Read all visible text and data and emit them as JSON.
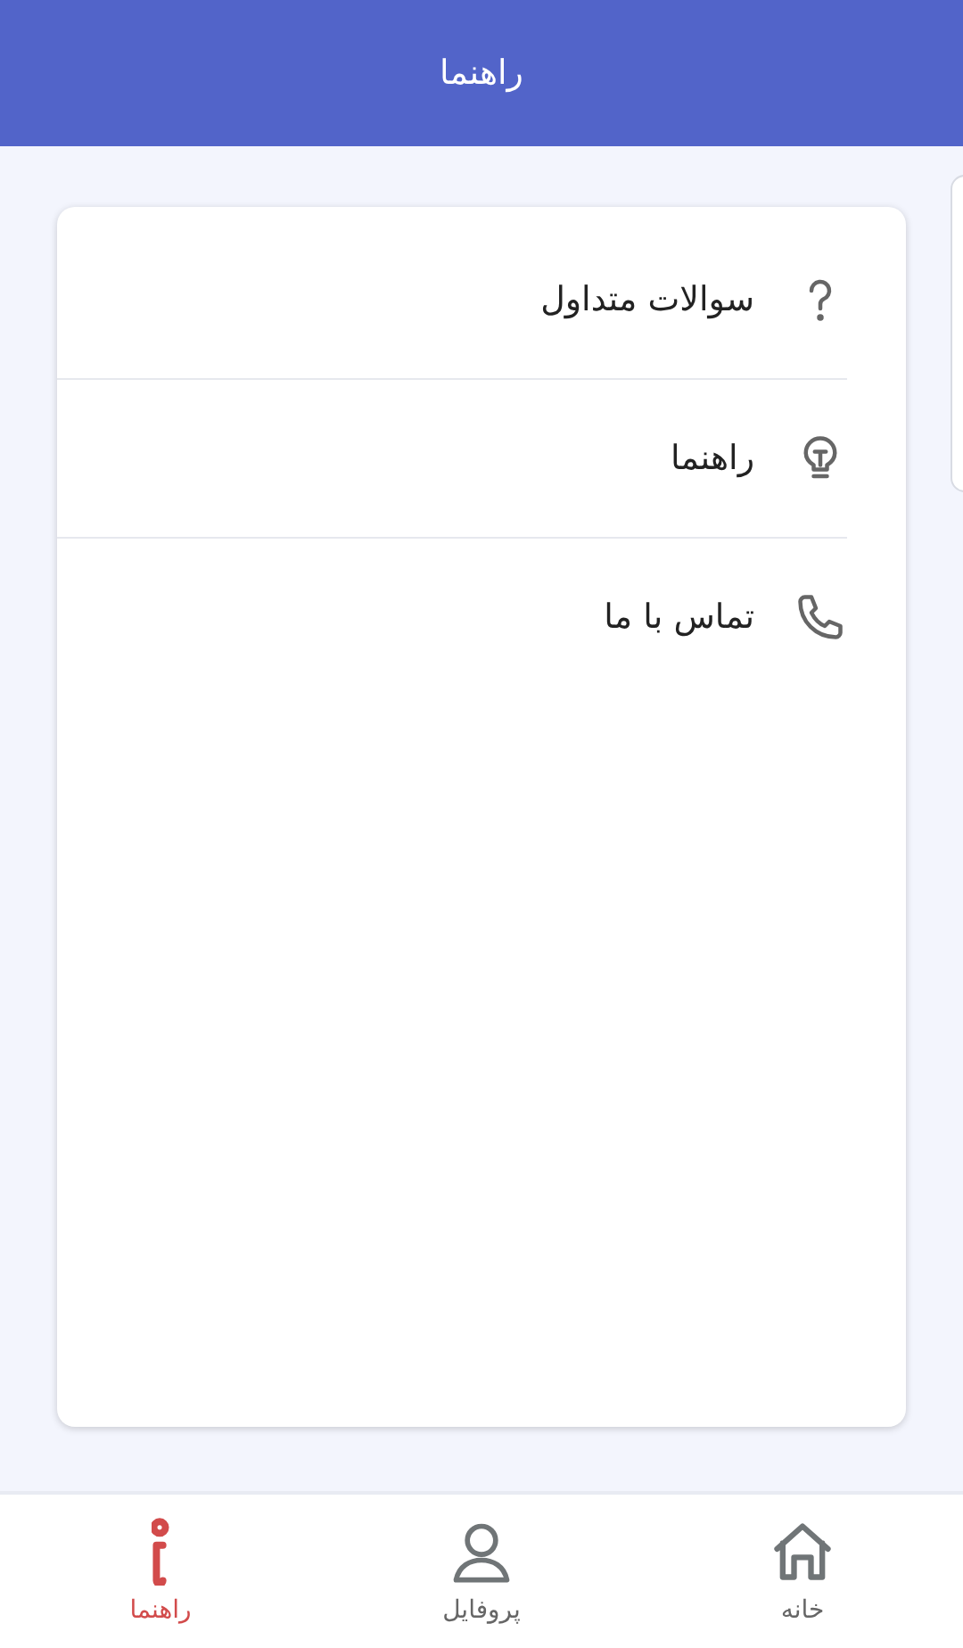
{
  "header": {
    "title": "راهنما"
  },
  "menu": [
    {
      "label": "سوالات متداول",
      "kind": "question"
    },
    {
      "label": "راهنما",
      "kind": "bulb"
    },
    {
      "label": "تماس با ما",
      "kind": "phone"
    }
  ],
  "bottom_nav": [
    {
      "label": "خانه",
      "kind": "home",
      "selected": false
    },
    {
      "label": "پروفایل",
      "kind": "profile",
      "selected": false
    },
    {
      "label": "راهنما",
      "kind": "info",
      "selected": true
    }
  ]
}
